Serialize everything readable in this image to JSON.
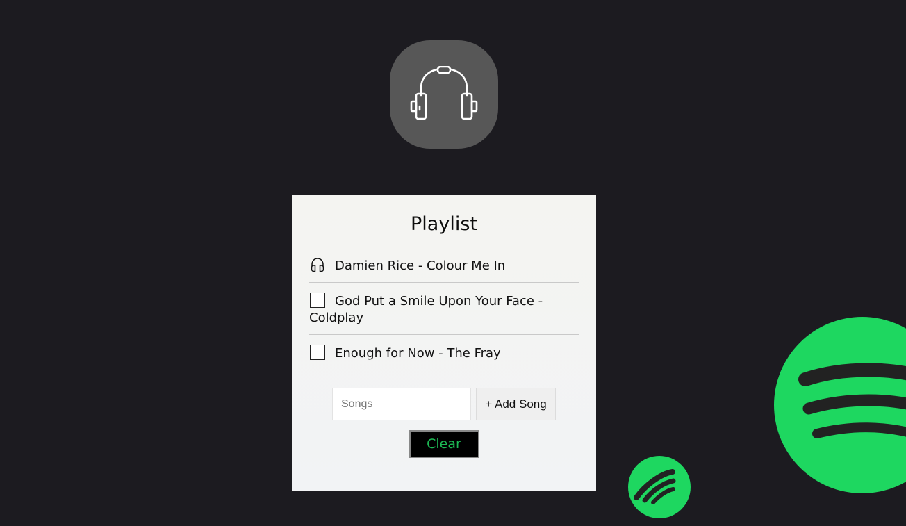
{
  "playlist": {
    "title": "Playlist",
    "songs": [
      {
        "label": "Damien Rice - Colour Me In",
        "marker": "headphones-icon"
      },
      {
        "label": "God Put a Smile Upon Your Face - Coldplay",
        "marker": "checkbox"
      },
      {
        "label": "Enough for Now - The Fray",
        "marker": "checkbox"
      }
    ]
  },
  "form": {
    "input_placeholder": "Songs",
    "input_value": "",
    "add_label": "+ Add Song",
    "clear_label": "Clear"
  },
  "colors": {
    "background": "#1c1b20",
    "app_icon_bg": "#575757",
    "spotify_green": "#1ed760",
    "clear_text": "#1db954"
  },
  "icons": {
    "app_icon": "headphones-icon",
    "decor_logos": "spotify-logo-icon"
  }
}
